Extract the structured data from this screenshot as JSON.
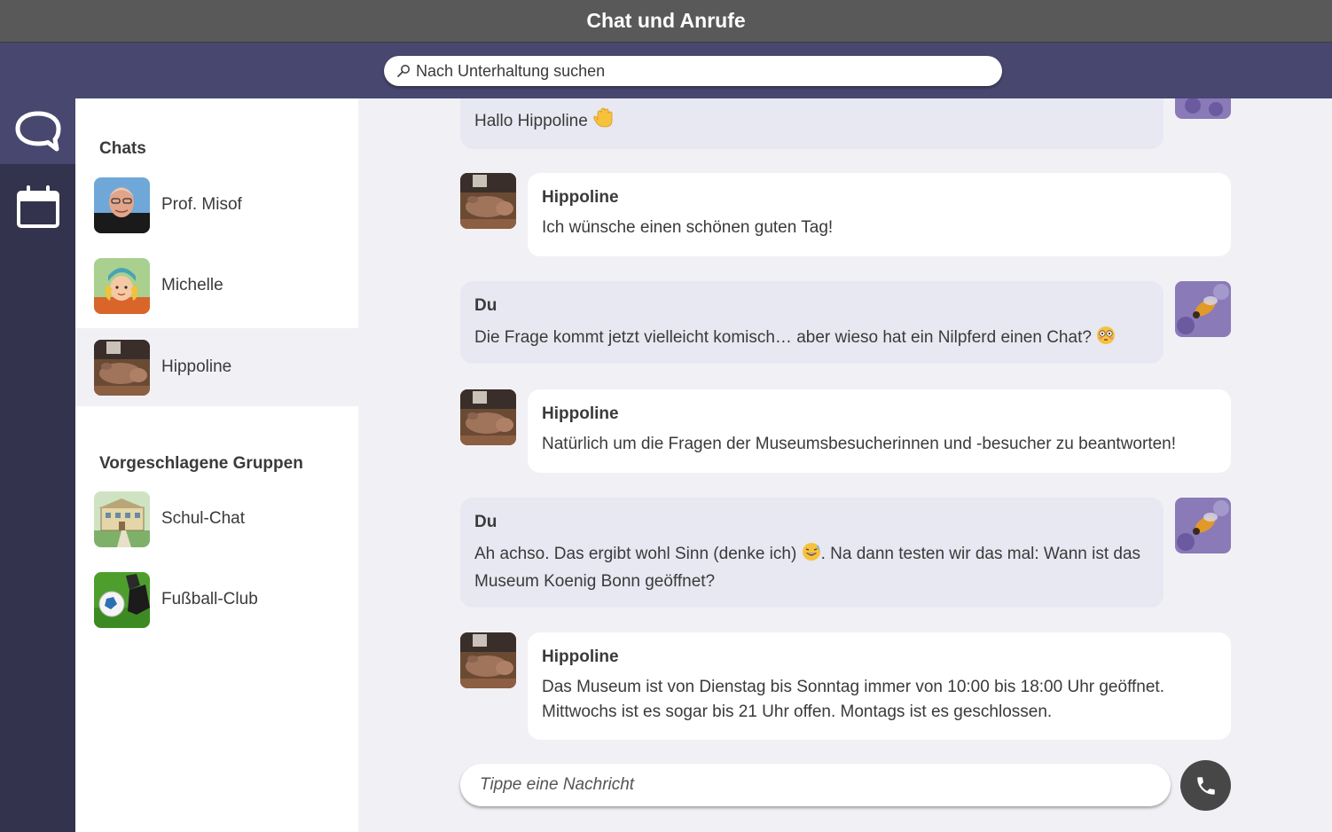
{
  "window": {
    "title": "Chat und Anrufe"
  },
  "search": {
    "placeholder": "Nach Unterhaltung suchen"
  },
  "rail": {
    "items": [
      {
        "icon": "chat-icon",
        "active": true
      },
      {
        "icon": "calendar-icon",
        "active": false
      }
    ]
  },
  "sidebar": {
    "chats_title": "Chats",
    "chats": [
      {
        "name": "Prof. Misof",
        "avatar": "man-photo"
      },
      {
        "name": "Michelle",
        "avatar": "cartoon-girl"
      },
      {
        "name": "Hippoline",
        "avatar": "hippo-photo",
        "selected": true
      }
    ],
    "groups_title": "Vorgeschlagene Gruppen",
    "groups": [
      {
        "name": "Schul-Chat",
        "avatar": "school-building"
      },
      {
        "name": "Fußball-Club",
        "avatar": "football"
      }
    ]
  },
  "messages": [
    {
      "from": "me",
      "sender": "",
      "text": "Hallo Hippoline",
      "emoji": "waving-hand"
    },
    {
      "from": "them",
      "sender": "Hippoline",
      "text": "Ich wünsche einen schönen guten Tag!"
    },
    {
      "from": "me",
      "sender": "Du",
      "text": "Die Frage kommt jetzt vielleicht komisch… aber wieso hat ein Nilpferd einen Chat?",
      "emoji": "flushed-face"
    },
    {
      "from": "them",
      "sender": "Hippoline",
      "text": "Natürlich um die Fragen der Museumsbesucherinnen und -besucher zu beantworten!"
    },
    {
      "from": "me",
      "sender": "Du",
      "text_before": "Ah achso. Das ergibt wohl Sinn (denke ich)",
      "emoji": "grinning-sweat-face",
      "text_after_1": ". Na dann testen wir das mal: Wann ist das",
      "text_after_2": "Museum Koenig Bonn geöffnet?"
    },
    {
      "from": "them",
      "sender": "Hippoline",
      "line1": "Das Museum ist von Dienstag bis Sonntag immer von 10:00 bis 18:00 Uhr geöffnet.",
      "line2": "Mittwochs ist es sogar bis 21 Uhr offen. Montags ist es geschlossen."
    }
  ],
  "composer": {
    "placeholder": "Tippe eine Nachricht"
  },
  "colors": {
    "header": "#595959",
    "accent": "#474770",
    "rail": "#33334d",
    "bubble_me": "#e8e8f3",
    "bubble_them": "#ffffff",
    "background": "#f1f1f5"
  }
}
